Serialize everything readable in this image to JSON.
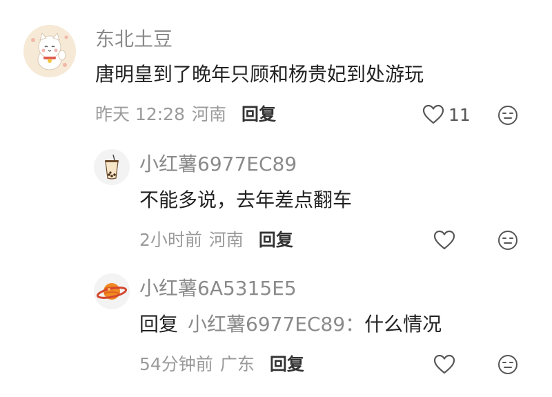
{
  "comments": [
    {
      "username": "东北土豆",
      "content": "唐明皇到了晚年只顾和杨贵妃到处游玩",
      "time": "昨天 12:28",
      "location": "河南",
      "reply_label": "回复",
      "like_count": "11",
      "avatar_icon": "lucky-cat-avatar-icon"
    },
    {
      "username": "小红薯6977EC89",
      "content": "不能多说，去年差点翻车",
      "time": "2小时前",
      "location": "河南",
      "reply_label": "回复",
      "avatar_icon": "bubble-tea-avatar-icon"
    },
    {
      "username": "小红薯6A5315E5",
      "reply_prefix": "回复",
      "reply_target": "小红薯6977EC89：",
      "content": "什么情况",
      "time": "54分钟前",
      "location": "广东",
      "reply_label": "回复",
      "avatar_icon": "planet-avatar-icon"
    }
  ],
  "colors": {
    "username": "#8a8a8a",
    "content": "#222222",
    "meta": "#9a9a9a",
    "icon": "#555555"
  }
}
